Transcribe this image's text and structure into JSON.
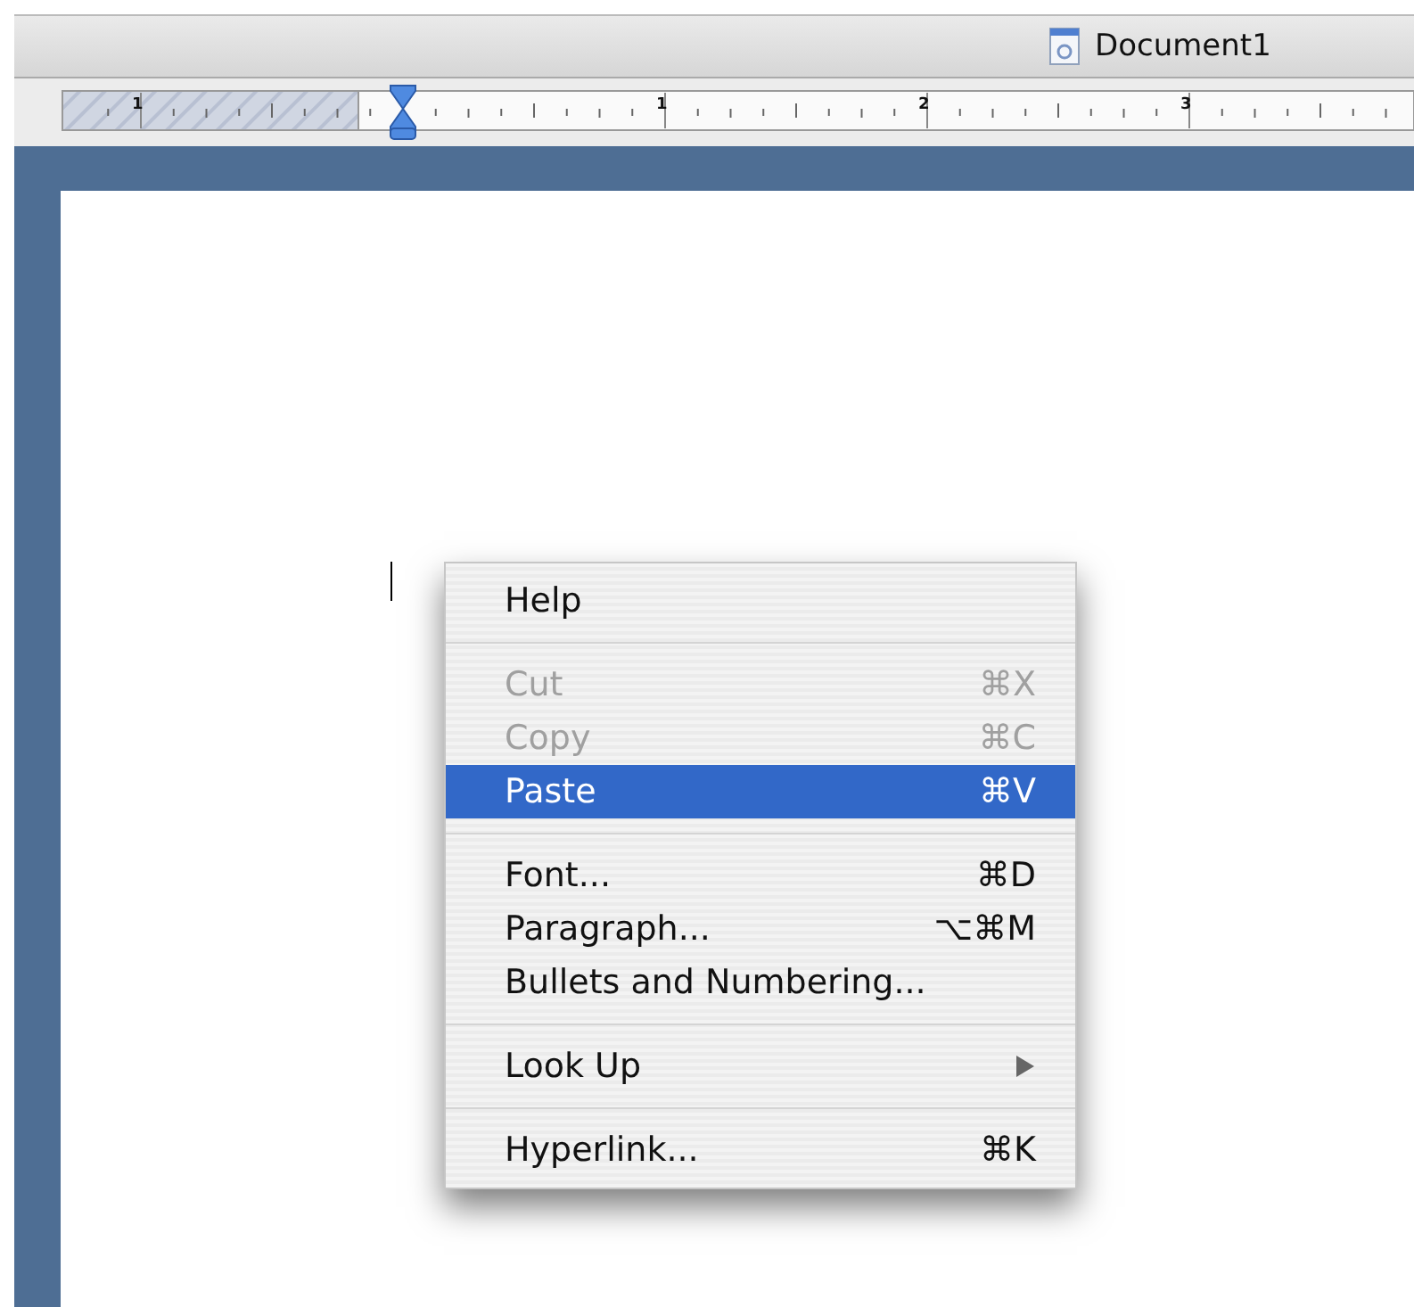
{
  "window": {
    "title": "Document1"
  },
  "ruler": {
    "labels": [
      "1",
      "1",
      "2",
      "3"
    ]
  },
  "context_menu": {
    "groups": [
      [
        {
          "label": "Help",
          "disabled": false,
          "selected": false,
          "submenu": false
        }
      ],
      [
        {
          "label": "Cut",
          "shortcut": "⌘X",
          "disabled": true,
          "selected": false,
          "submenu": false
        },
        {
          "label": "Copy",
          "shortcut": "⌘C",
          "disabled": true,
          "selected": false,
          "submenu": false
        },
        {
          "label": "Paste",
          "shortcut": "⌘V",
          "disabled": false,
          "selected": true,
          "submenu": false
        }
      ],
      [
        {
          "label": "Font...",
          "shortcut": "⌘D",
          "disabled": false,
          "selected": false,
          "submenu": false
        },
        {
          "label": "Paragraph...",
          "shortcut": "⌥⌘M",
          "disabled": false,
          "selected": false,
          "submenu": false
        },
        {
          "label": "Bullets and Numbering...",
          "disabled": false,
          "selected": false,
          "submenu": false
        }
      ],
      [
        {
          "label": "Look Up",
          "disabled": false,
          "selected": false,
          "submenu": true
        }
      ],
      [
        {
          "label": "Hyperlink...",
          "shortcut": "⌘K",
          "disabled": false,
          "selected": false,
          "submenu": false
        }
      ]
    ]
  }
}
